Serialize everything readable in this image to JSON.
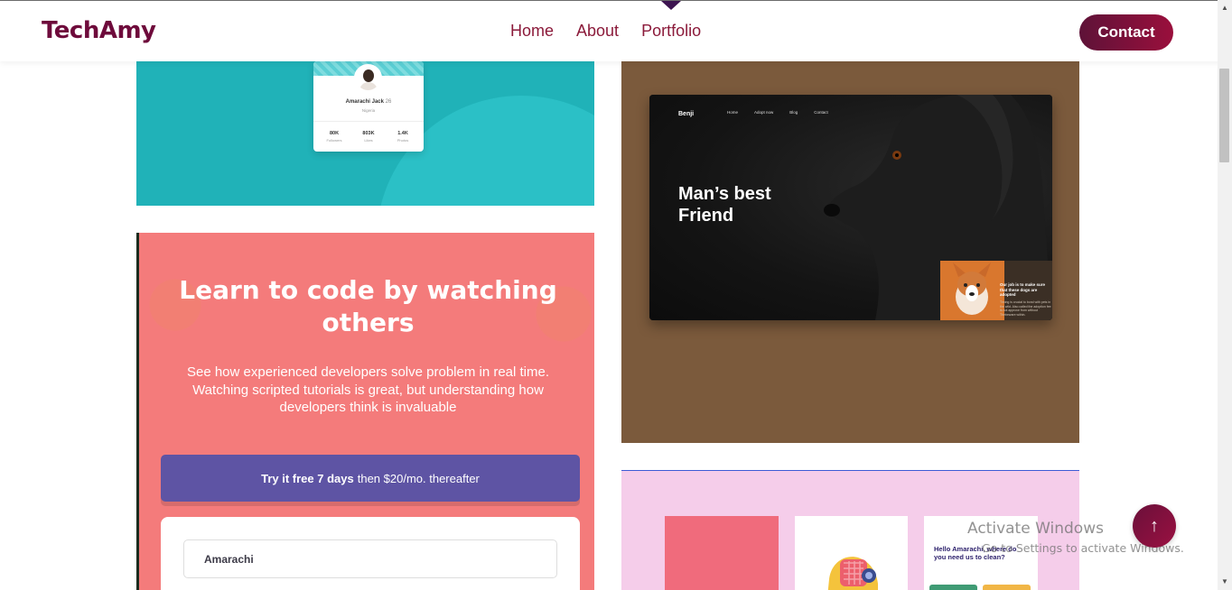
{
  "header": {
    "logo": "TechAmy",
    "nav": [
      {
        "label": "Home"
      },
      {
        "label": "About"
      },
      {
        "label": "Portfolio"
      }
    ],
    "contact": "Contact"
  },
  "profile_card": {
    "name": "Amarachi Jack",
    "age": "26",
    "location": "Nigeria",
    "stats": [
      {
        "value": "80K",
        "label": "Followers"
      },
      {
        "value": "803K",
        "label": "Likes"
      },
      {
        "value": "1.4K",
        "label": "Photos"
      }
    ]
  },
  "learn_card": {
    "title": "Learn to code by watching others",
    "text": "See how experienced developers solve problem in real time. Watching scripted tutorials is great, but understanding how developers think is invaluable",
    "trial_bold": "Try it free 7 days",
    "trial_rest": "then $20/mo. thereafter",
    "input_value": "Amarachi"
  },
  "dog_card": {
    "logo": "Benji",
    "nav": [
      "Home",
      "Adopt now",
      "Blog",
      "Contact"
    ],
    "title": "Man’s best Friend",
    "puppy_text": "Our job is to make sure that these dogs are adopted",
    "puppy_sub": "Timing is crucial to bond with pets in the wild. Also called the adoption fee is not approve from without Thebeware within."
  },
  "pink_card": {
    "hello": "Hello Amarachi, where do you need us to clean?"
  },
  "overlay": {
    "activate_title": "Activate Windows",
    "activate_sub": "Go to Settings to activate Windows."
  },
  "icons": {
    "scroll_up": "up-arrow-icon",
    "scroll_to_top": "arrow-up-icon"
  }
}
